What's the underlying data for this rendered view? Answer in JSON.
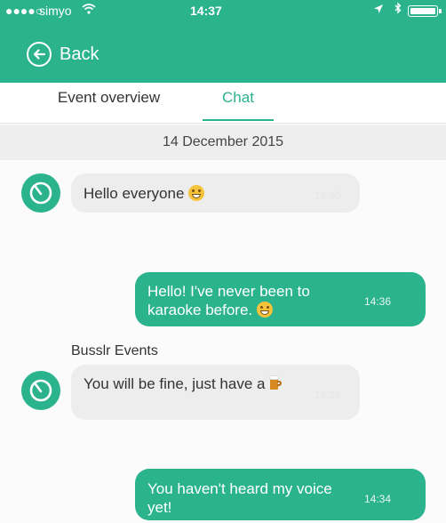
{
  "status_bar": {
    "signal": "●●●●○",
    "carrier": "simyo",
    "time": "14:37"
  },
  "header": {
    "back_label": "Back"
  },
  "tabs": [
    {
      "label": "Event overview",
      "active": false
    },
    {
      "label": "Chat",
      "active": true
    }
  ],
  "chat": {
    "date": "14 December 2015",
    "messages": [
      {
        "direction": "in",
        "text": "Hello everyone",
        "emoji": "grinning-face",
        "time": "14:05"
      },
      {
        "direction": "out",
        "text": "Hello! I've never been to karaoke before.",
        "emoji": "grinning-face",
        "time": "14:36"
      },
      {
        "direction": "in",
        "sender": "Busslr Events",
        "text": "You will be fine, just have a",
        "emoji": "beer-mug",
        "time": "14:36"
      },
      {
        "direction": "out",
        "text": "You haven't heard my voice yet!",
        "time": "14:34"
      }
    ]
  },
  "colors": {
    "accent": "#2bb38e",
    "incoming_bubble": "#ededed",
    "date_bar": "#eeeeee"
  }
}
